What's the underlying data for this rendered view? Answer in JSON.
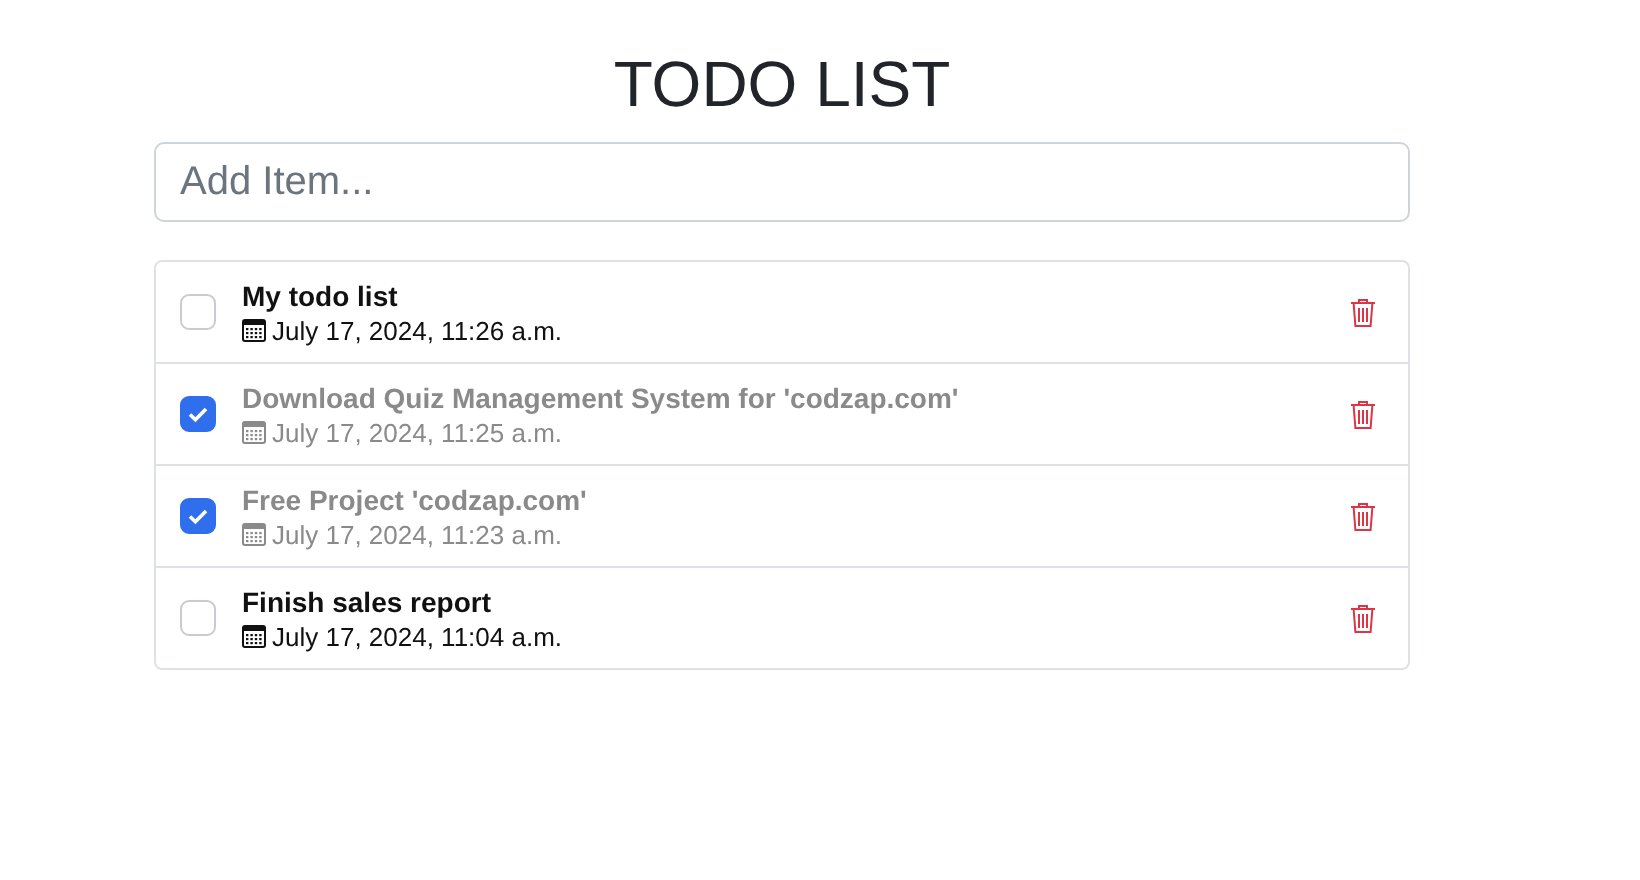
{
  "title": "TODO LIST",
  "add_field": {
    "placeholder": "Add Item..."
  },
  "items": [
    {
      "text": "My todo list",
      "date": "July 17, 2024, 11:26 a.m.",
      "checked": false
    },
    {
      "text": "Download Quiz Management System for 'codzap.com'",
      "date": "July 17, 2024, 11:25 a.m.",
      "checked": true
    },
    {
      "text": "Free Project 'codzap.com'",
      "date": "July 17, 2024, 11:23 a.m.",
      "checked": true
    },
    {
      "text": "Finish sales report",
      "date": "July 17, 2024, 11:04 a.m.",
      "checked": false
    }
  ]
}
